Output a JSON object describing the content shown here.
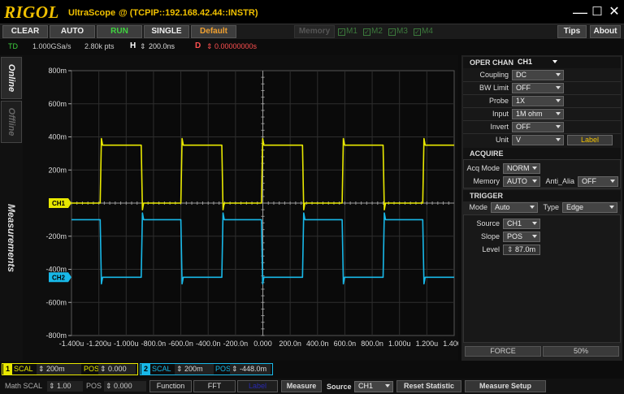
{
  "window": {
    "logo": "RIGOL",
    "product": "UltraScope",
    "resource": "@ (TCPIP::192.168.42.44::INSTR)",
    "minimize": "—",
    "maximize": "☐",
    "close": "✕"
  },
  "toolbar": {
    "clear": "CLEAR",
    "auto": "AUTO",
    "run": "RUN",
    "single": "SINGLE",
    "default": "Default",
    "memory": "Memory",
    "m1": "M1",
    "m2": "M2",
    "m3": "M3",
    "m4": "M4",
    "tips": "Tips",
    "about": "About"
  },
  "status": {
    "mode": "TD",
    "sample_rate": "1.000GSa/s",
    "points": "2.80k pts",
    "h_label": "H",
    "h_value": "200.0ns",
    "d_label": "D",
    "d_value": "0.00000000s"
  },
  "left_tabs": {
    "online": "Online",
    "offline": "Offline",
    "measurements": "Measurements",
    "expand": "»"
  },
  "chart_data": {
    "type": "line",
    "x_ticks": [
      "-1.400u",
      "-1.200u",
      "-1.000u",
      "-800.0n",
      "-600.0n",
      "-400.0n",
      "-200.0n",
      "0.000",
      "200.0n",
      "400.0n",
      "600.0n",
      "800.0n",
      "1.000u",
      "1.200u",
      "1.400u"
    ],
    "y_ticks": [
      "800m",
      "600m",
      "400m",
      "200m",
      "0.00",
      "-200m",
      "-400m",
      "-600m",
      "-800m"
    ],
    "xlim": [
      -1.4,
      1.4
    ],
    "ylim": [
      -800,
      800
    ],
    "x_unit": "us",
    "y_unit": "mV",
    "grid": true,
    "colors": {
      "ch1": "#e8e800",
      "ch2": "#18b8e8",
      "grid": "#2e2e2e",
      "axis": "#9a9a9a"
    },
    "series": [
      {
        "name": "CH1",
        "marker_label": "CH1",
        "offset_mV": 0,
        "low_mV": 0,
        "high_mV": 350,
        "rises_us": [
          -1.19,
          -0.6,
          -0.01,
          0.58,
          1.17
        ],
        "falls_us": [
          -0.89,
          -0.3,
          0.29,
          0.88
        ]
      },
      {
        "name": "CH2",
        "marker_label": "CH2",
        "offset_mV": -448,
        "low_mV": -448,
        "high_mV": -100,
        "rises_us": [
          -0.89,
          -0.3,
          0.29,
          0.88
        ],
        "falls_us": [
          -1.19,
          -0.6,
          -0.01,
          0.58,
          1.17
        ]
      }
    ]
  },
  "oper_chan": {
    "title": "OPER CHAN",
    "channel": "CH1",
    "rows": [
      {
        "label": "Coupling",
        "value": "DC"
      },
      {
        "label": "BW Limit",
        "value": "OFF"
      },
      {
        "label": "Probe",
        "value": "1X"
      },
      {
        "label": "Input",
        "value": "1M ohm"
      },
      {
        "label": "Invert",
        "value": "OFF"
      },
      {
        "label": "Unit",
        "value": "V"
      }
    ],
    "label_button": "Label"
  },
  "acquire": {
    "title": "ACQUIRE",
    "acq_mode_label": "Acq Mode",
    "acq_mode_value": "NORM",
    "memory_label": "Memory",
    "memory_value": "AUTO",
    "anti_alias_label": "Anti_Alia",
    "anti_alias_value": "OFF"
  },
  "trigger": {
    "title": "TRIGGER",
    "mode_label": "Mode",
    "mode_value": "Auto",
    "type_label": "Type",
    "type_value": "Edge",
    "source_label": "Source",
    "source_value": "CH1",
    "slope_label": "Slope",
    "slope_value": "POS",
    "level_label": "Level",
    "level_value": "87.0m",
    "force": "FORCE",
    "percent": "50%"
  },
  "bottom": {
    "ch1_num": "1",
    "ch1_scal_label": "SCAL",
    "ch1_scal": "200m",
    "ch1_pos_label": "POS",
    "ch1_pos": "0.000",
    "ch2_num": "2",
    "ch2_scal_label": "SCAL",
    "ch2_scal": "200m",
    "ch2_pos_label": "POS",
    "ch2_pos": "-448.0m",
    "math_scal_label": "Math SCAL",
    "math_scal": "1.00",
    "math_pos_label": "POS",
    "math_pos": "0.000",
    "function": "Function",
    "fft": "FFT",
    "label": "Label",
    "measure": "Measure",
    "source_label": "Source",
    "source_value": "CH1",
    "reset_statistic": "Reset  Statistic",
    "measure_setup": "Measure Setup"
  }
}
